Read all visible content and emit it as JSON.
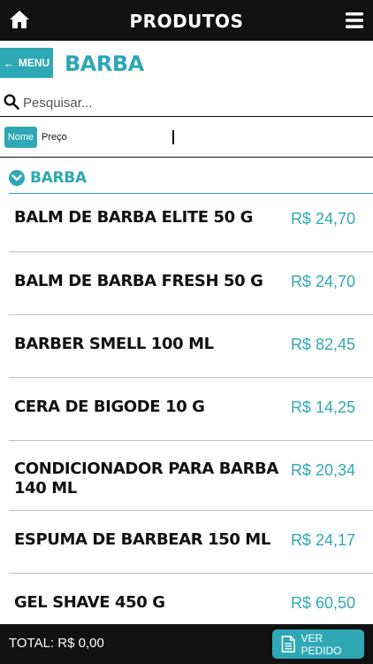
{
  "header": {
    "title": "PRODUTOS",
    "home_icon": "home-icon",
    "menu_icon": "hamburger-menu-icon"
  },
  "section": {
    "back_label": "MENU",
    "title": "BARBA"
  },
  "search": {
    "placeholder": "Pesquisar..."
  },
  "sort": {
    "nome_label": "Nome",
    "preco_label": "Preço"
  },
  "category": {
    "label": "BARBA"
  },
  "products": [
    {
      "name": "BALM DE BARBA ELITE 50 G",
      "price": "R$ 24,70"
    },
    {
      "name": "BALM DE BARBA FRESH 50 G",
      "price": "R$ 24,70"
    },
    {
      "name": "BARBER SMELL 100 ML",
      "price": "R$ 82,45"
    },
    {
      "name": "CERA DE BIGODE 10 G",
      "price": "R$ 14,25"
    },
    {
      "name": "CONDICIONADOR PARA BARBA 140 ML",
      "price": "R$ 20,34"
    },
    {
      "name": "ESPUMA DE BARBEAR 150 ML",
      "price": "R$ 24,17"
    },
    {
      "name": "GEL SHAVE 450 G",
      "price": "R$ 60,50"
    }
  ],
  "footer": {
    "total": "TOTAL: R$ 0,00",
    "order_button": "VER PEDIDO"
  },
  "colors": {
    "accent": "#2ea8b5",
    "bar": "#111111"
  }
}
